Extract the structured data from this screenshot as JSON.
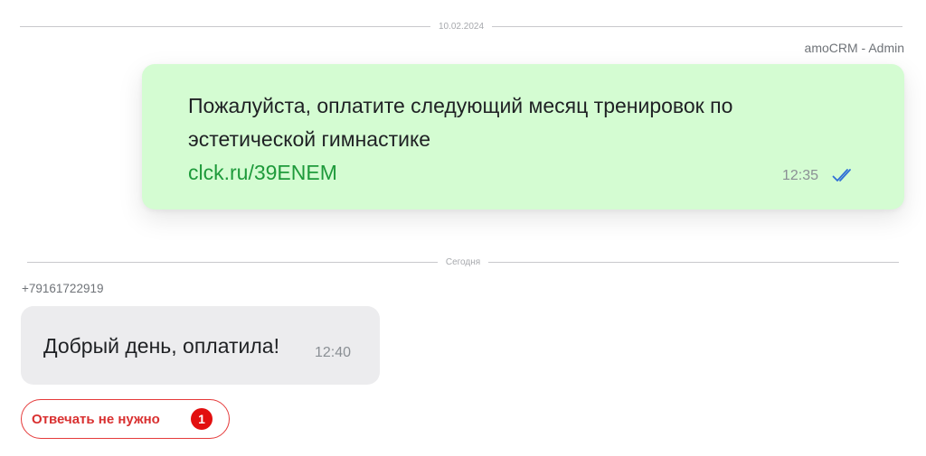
{
  "dividers": {
    "top_date": "10.02.2024",
    "today": "Сегодня"
  },
  "outgoing": {
    "sender": "amoCRM - Admin",
    "text": "Пожалуйста, оплатите следующий месяц тренировок по эстетической гимнастике",
    "link": "clck.ru/39ENEM",
    "time": "12:35",
    "status_icon": "double-check-icon",
    "bubble_color": "#d4fcd2",
    "link_color": "#1e9a3b",
    "check_color": "#2f6fd6"
  },
  "incoming": {
    "sender": "+79161722919",
    "text": "Добрый день, оплатила!",
    "time": "12:40",
    "bubble_color": "#ececee"
  },
  "noreply_button": {
    "label": "Отвечать не нужно",
    "count": "1",
    "accent": "#e53a3a"
  }
}
